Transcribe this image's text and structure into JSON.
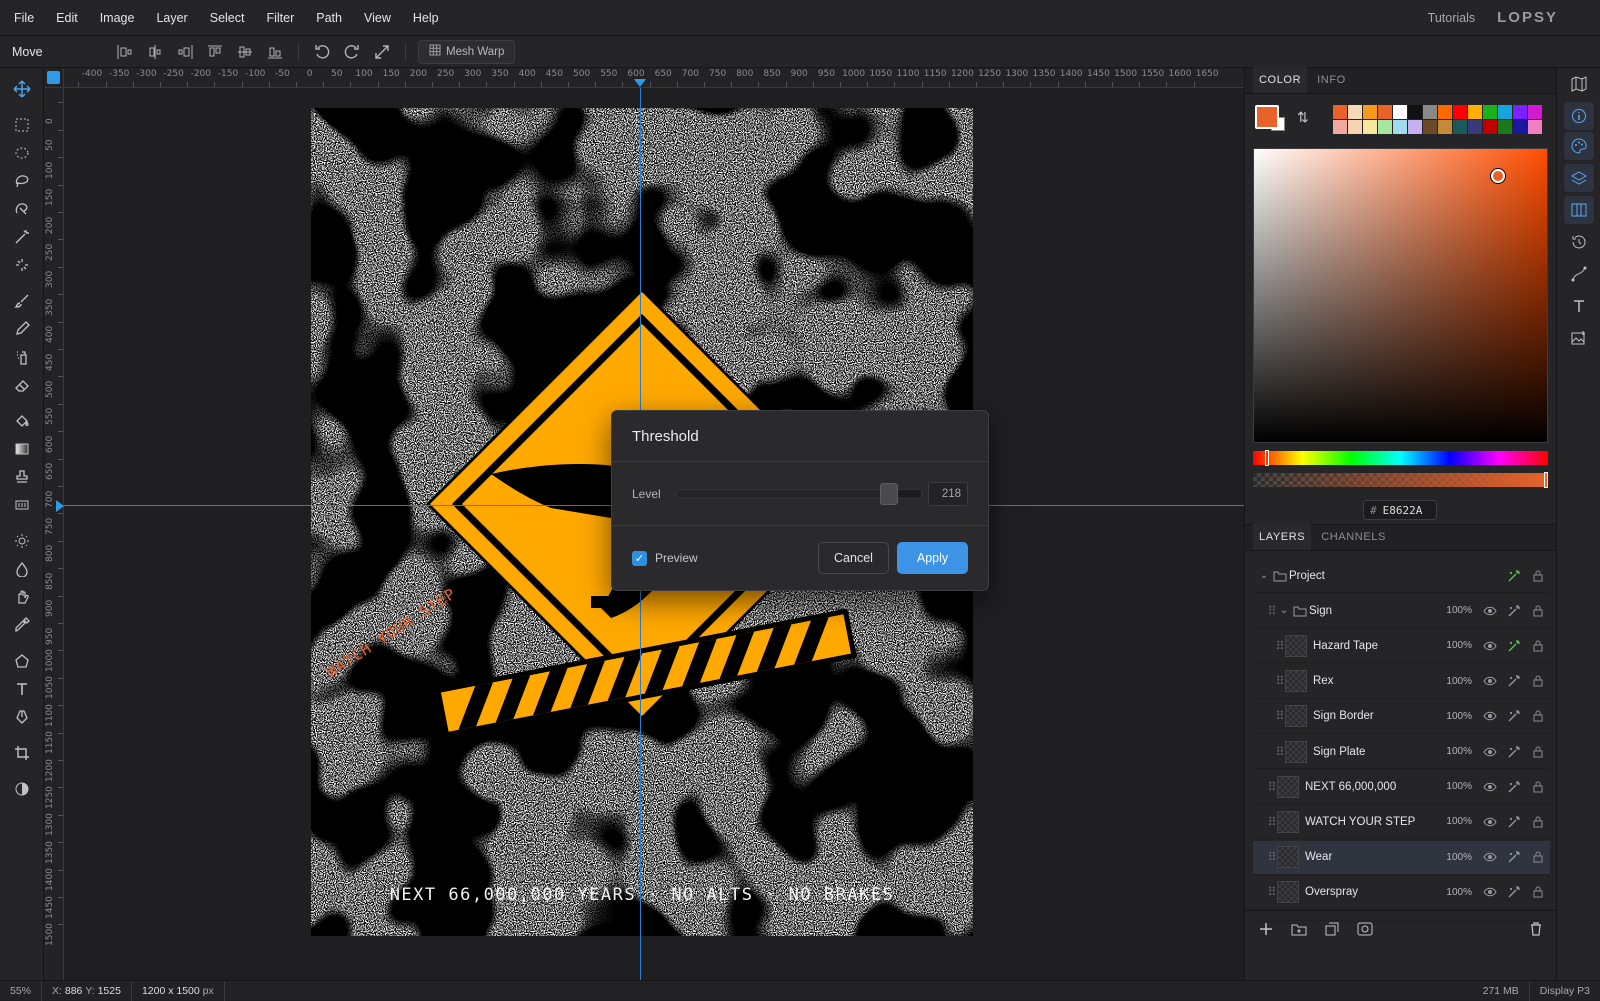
{
  "menu": [
    "File",
    "Edit",
    "Image",
    "Layer",
    "Select",
    "Filter",
    "Path",
    "View",
    "Help"
  ],
  "header": {
    "tutorials": "Tutorials",
    "logo": "LOPSY"
  },
  "options": {
    "tool_name": "Move",
    "mesh_warp": "Mesh Warp"
  },
  "ruler": {
    "h_labels": [
      "-400",
      "-350",
      "-300",
      "-250",
      "-200",
      "-150",
      "-100",
      "-50",
      "0",
      "50",
      "100",
      "150",
      "200",
      "250",
      "300",
      "350",
      "400",
      "450",
      "500",
      "550",
      "600",
      "650",
      "700",
      "750",
      "800",
      "850",
      "900",
      "950",
      "1000",
      "1050",
      "1100",
      "1150",
      "1200",
      "1250",
      "1300",
      "1350",
      "1400",
      "1450",
      "1500",
      "1550",
      "1600",
      "1650"
    ],
    "v_labels": [
      "0",
      "50",
      "100",
      "150",
      "200",
      "250",
      "300",
      "350",
      "400",
      "450",
      "500",
      "550",
      "600",
      "650",
      "700",
      "750",
      "800",
      "850",
      "900",
      "950",
      "1000",
      "1050",
      "1100",
      "1150",
      "1200",
      "1250",
      "1300",
      "1350",
      "1400",
      "1450",
      "1500"
    ]
  },
  "artwork": {
    "bottom_text": "NEXT 66,000,000 YEARS · NO ALTS · NO BRAKES",
    "diagonal_text": "WATCH YOUR STEP"
  },
  "dialog": {
    "title": "Threshold",
    "level_label": "Level",
    "level_value": "218",
    "level_fraction": 0.86,
    "preview_label": "Preview",
    "preview_checked": true,
    "cancel": "Cancel",
    "apply": "Apply"
  },
  "color_panel": {
    "tabs": [
      "COLOR",
      "INFO"
    ],
    "foreground": "#E8622A",
    "background": "#FFFFFF",
    "hex_prefix": "#",
    "hex": "E8622A",
    "swatches_top": [
      "#e8622a",
      "#f5d9b8",
      "#f59a1d",
      "#e8622a",
      "#ffffff",
      "#111111",
      "#888888",
      "#ff6a00",
      "#ff0000",
      "#ffb000",
      "#19b319",
      "#17a2e0",
      "#7a22ff",
      "#d11ad1"
    ],
    "swatches_bottom": [
      "#f0a8a0",
      "#f7d3b0",
      "#f6e79c",
      "#a6e6a0",
      "#9fdcf0",
      "#c8b0f0",
      "#6b4a2a",
      "#c48a3a",
      "#1a5a5a",
      "#3a3a7a",
      "#c00000",
      "#1a7a1a",
      "#1a1aa0",
      "#f080c0"
    ]
  },
  "layers_panel": {
    "tabs": [
      "LAYERS",
      "CHANNELS"
    ],
    "rows": [
      {
        "name": "Project",
        "opacity": "",
        "group": true,
        "indent": 0,
        "selected": false
      },
      {
        "name": "Sign",
        "opacity": "100%",
        "group": true,
        "indent": 1,
        "selected": false
      },
      {
        "name": "Hazard Tape",
        "opacity": "100%",
        "group": false,
        "indent": 2,
        "selected": false
      },
      {
        "name": "Rex",
        "opacity": "100%",
        "group": false,
        "indent": 2,
        "selected": false
      },
      {
        "name": "Sign Border",
        "opacity": "100%",
        "group": false,
        "indent": 2,
        "selected": false
      },
      {
        "name": "Sign Plate",
        "opacity": "100%",
        "group": false,
        "indent": 2,
        "selected": false
      },
      {
        "name": "NEXT 66,000,000",
        "opacity": "100%",
        "group": false,
        "indent": 1,
        "selected": false
      },
      {
        "name": "WATCH YOUR STEP",
        "opacity": "100%",
        "group": false,
        "indent": 1,
        "selected": false
      },
      {
        "name": "Wear",
        "opacity": "100%",
        "group": false,
        "indent": 1,
        "selected": true
      },
      {
        "name": "Overspray",
        "opacity": "100%",
        "group": false,
        "indent": 1,
        "selected": false
      }
    ]
  },
  "status": {
    "zoom": "55%",
    "x_label": "X:",
    "x": "886",
    "y_label": "Y:",
    "y": "1525",
    "size": "1200 x 1500",
    "unit": "px",
    "memory": "271 MB",
    "display": "Display P3"
  }
}
